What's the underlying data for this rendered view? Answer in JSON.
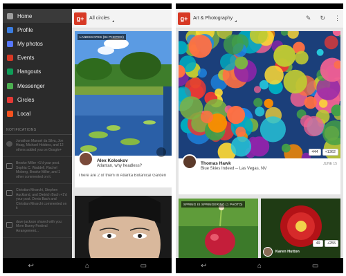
{
  "left": {
    "drawer": {
      "items": [
        {
          "label": "Home",
          "color": "#9e9e9e"
        },
        {
          "label": "Profile",
          "color": "#3b7de0"
        },
        {
          "label": "My photos",
          "color": "#5677fc"
        },
        {
          "label": "Events",
          "color": "#d73925"
        },
        {
          "label": "Hangouts",
          "color": "#0f9d58"
        },
        {
          "label": "Messenger",
          "color": "#4caf50"
        },
        {
          "label": "Circles",
          "color": "#e53935"
        },
        {
          "label": "Local",
          "color": "#f4511e"
        }
      ],
      "notifications_header": "NOTIFICATIONS",
      "notifications": [
        {
          "text": "Jonathan Manuel da Silva, Jon Hoag, Michael Hobbes, and 12 others added you on Google+"
        },
        {
          "text": "Brooke Miller +1'd your post. Sophia C. Waddell, Rachel Moberg, Brooke Miller, and 1 other commented on it."
        },
        {
          "text": "Christian Mirarchi, Stephen Auckland, and Dietrich Bach +1'd your post. Denis Bach and Christian Mirarchi commented on it"
        },
        {
          "text": "dave jackson shared with you: More Bunny Festival Arrangement..."
        }
      ]
    },
    "appbar": {
      "logo": "g+",
      "title": "All circles"
    },
    "post1": {
      "tag": "LANDSCAPES (84 PHOTOS)",
      "author": "Alex Koloskov",
      "subtitle": "Atlantan, why headless?",
      "comment": "There are 2 of them in Atlanta Botanical Garden"
    }
  },
  "right": {
    "appbar": {
      "logo": "g+",
      "title": "Art & Photography"
    },
    "post1": {
      "author": "Thomas Hawk",
      "subtitle": "Blue Skies Indeed -- Las Vegas, NV",
      "date": "JUNE 15",
      "comments": "444",
      "plusones": "+1362"
    },
    "post2": {
      "tag": "SPRING IS SPRINGERING (1 PHOTO)"
    },
    "post3": {
      "author": "Karen Hutton",
      "comments": "49",
      "plusones": "+255"
    }
  }
}
